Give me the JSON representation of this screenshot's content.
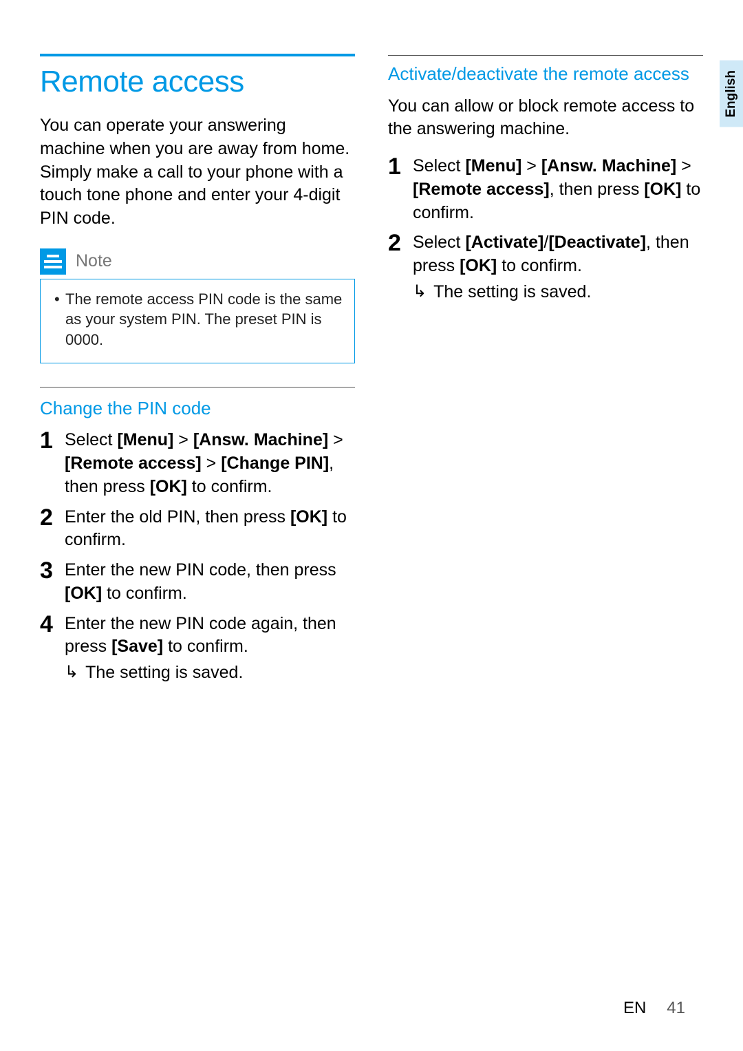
{
  "lang_tab": "English",
  "left": {
    "title": "Remote access",
    "intro": "You can operate your answering machine when you are away from home. Simply make a call to your phone with a touch tone phone and enter your 4-digit PIN code.",
    "note_label": "Note",
    "note_text": "The remote access PIN code is the same as your system PIN. The preset PIN is 0000.",
    "section2_title": "Change the PIN code",
    "steps": {
      "s1_a": "Select ",
      "s1_b": "[Menu]",
      "s1_c": " > ",
      "s1_d": "[Answ. Machine]",
      "s1_e": " > ",
      "s1_f": "[Remote access]",
      "s1_g": " > ",
      "s1_h": "[Change PIN]",
      "s1_i": ", then press ",
      "s1_j": "[OK]",
      "s1_k": " to confirm.",
      "s2_a": "Enter the old PIN, then press ",
      "s2_b": "[OK]",
      "s2_c": " to confirm.",
      "s3_a": "Enter the new PIN code, then press ",
      "s3_b": "[OK]",
      "s3_c": " to confirm.",
      "s4_a": "Enter the new PIN code again, then press ",
      "s4_b": "[Save]",
      "s4_c": " to confirm.",
      "result": "The setting is saved."
    }
  },
  "right": {
    "title": "Activate/deactivate the remote access",
    "intro": "You can allow or block remote access to the answering machine.",
    "steps": {
      "s1_a": "Select ",
      "s1_b": "[Menu]",
      "s1_c": " > ",
      "s1_d": "[Answ. Machine]",
      "s1_e": " > ",
      "s1_f": "[Remote access]",
      "s1_g": ", then press ",
      "s1_h": "[OK]",
      "s1_i": " to confirm.",
      "s2_a": "Select ",
      "s2_b": "[Activate]",
      "s2_c": "/",
      "s2_d": "[Deactivate]",
      "s2_e": ", then press ",
      "s2_f": "[OK]",
      "s2_g": " to confirm.",
      "result": "The setting is saved."
    }
  },
  "footer": {
    "lang": "EN",
    "page": "41"
  }
}
